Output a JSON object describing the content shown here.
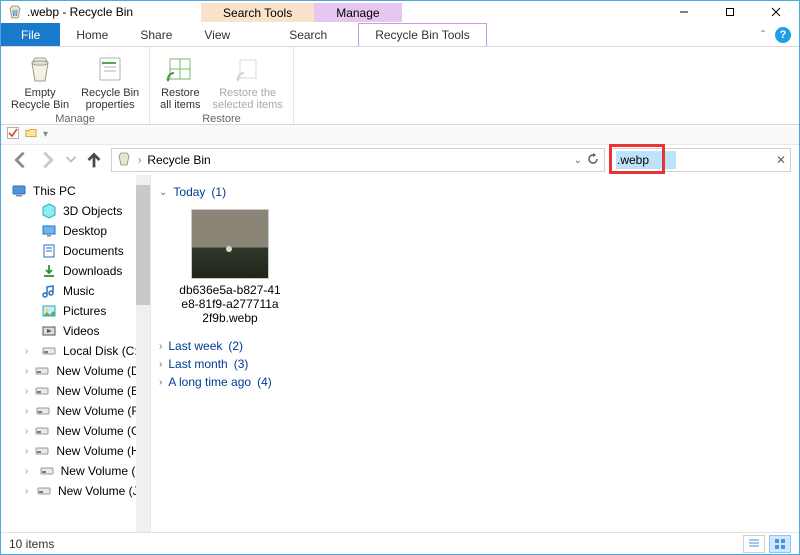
{
  "window": {
    "title": ".webp - Recycle Bin"
  },
  "context_tabs": {
    "search": "Search Tools",
    "manage": "Manage"
  },
  "ribbon_tabs": {
    "file": "File",
    "home": "Home",
    "share": "Share",
    "view": "View",
    "search": "Search",
    "tools": "Recycle Bin Tools"
  },
  "ribbon": {
    "manage": {
      "empty": "Empty\nRecycle Bin",
      "props": "Recycle Bin\nproperties",
      "group": "Manage"
    },
    "restore": {
      "all": "Restore\nall items",
      "selected": "Restore the\nselected items",
      "group": "Restore"
    }
  },
  "address": {
    "root": "Recycle Bin"
  },
  "search": {
    "value": ".webp"
  },
  "sidebar": {
    "thispc": "This PC",
    "items": [
      {
        "icon": "cube",
        "color": "#2aa7c4",
        "label": "3D Objects"
      },
      {
        "icon": "monitor",
        "color": "#2a6fc4",
        "label": "Desktop"
      },
      {
        "icon": "doc",
        "color": "#2a6fc4",
        "label": "Documents"
      },
      {
        "icon": "download",
        "color": "#2a8e3a",
        "label": "Downloads"
      },
      {
        "icon": "music",
        "color": "#2a6fc4",
        "label": "Music"
      },
      {
        "icon": "picture",
        "color": "#2aa7c4",
        "label": "Pictures"
      },
      {
        "icon": "video",
        "color": "#444",
        "label": "Videos"
      },
      {
        "icon": "disk",
        "color": "#888",
        "label": "Local Disk (C:)"
      },
      {
        "icon": "disk",
        "color": "#888",
        "label": "New Volume (D:)"
      },
      {
        "icon": "disk",
        "color": "#888",
        "label": "New Volume (E:)"
      },
      {
        "icon": "disk",
        "color": "#888",
        "label": "New Volume (F:)"
      },
      {
        "icon": "disk",
        "color": "#888",
        "label": "New Volume (G:)"
      },
      {
        "icon": "disk",
        "color": "#888",
        "label": "New Volume (H:)"
      },
      {
        "icon": "disk",
        "color": "#888",
        "label": "New Volume (I:)"
      },
      {
        "icon": "disk",
        "color": "#888",
        "label": "New Volume (J:)"
      }
    ]
  },
  "content": {
    "groups": [
      {
        "label": "Today",
        "count": "(1)",
        "expanded": true
      },
      {
        "label": "Last week",
        "count": "(2)",
        "expanded": false
      },
      {
        "label": "Last month",
        "count": "(3)",
        "expanded": false
      },
      {
        "label": "A long time ago",
        "count": "(4)",
        "expanded": false
      }
    ],
    "file": {
      "name": "db636e5a-b827-41e8-81f9-a277711a2f9b.webp"
    }
  },
  "status": {
    "count": "10 items"
  }
}
